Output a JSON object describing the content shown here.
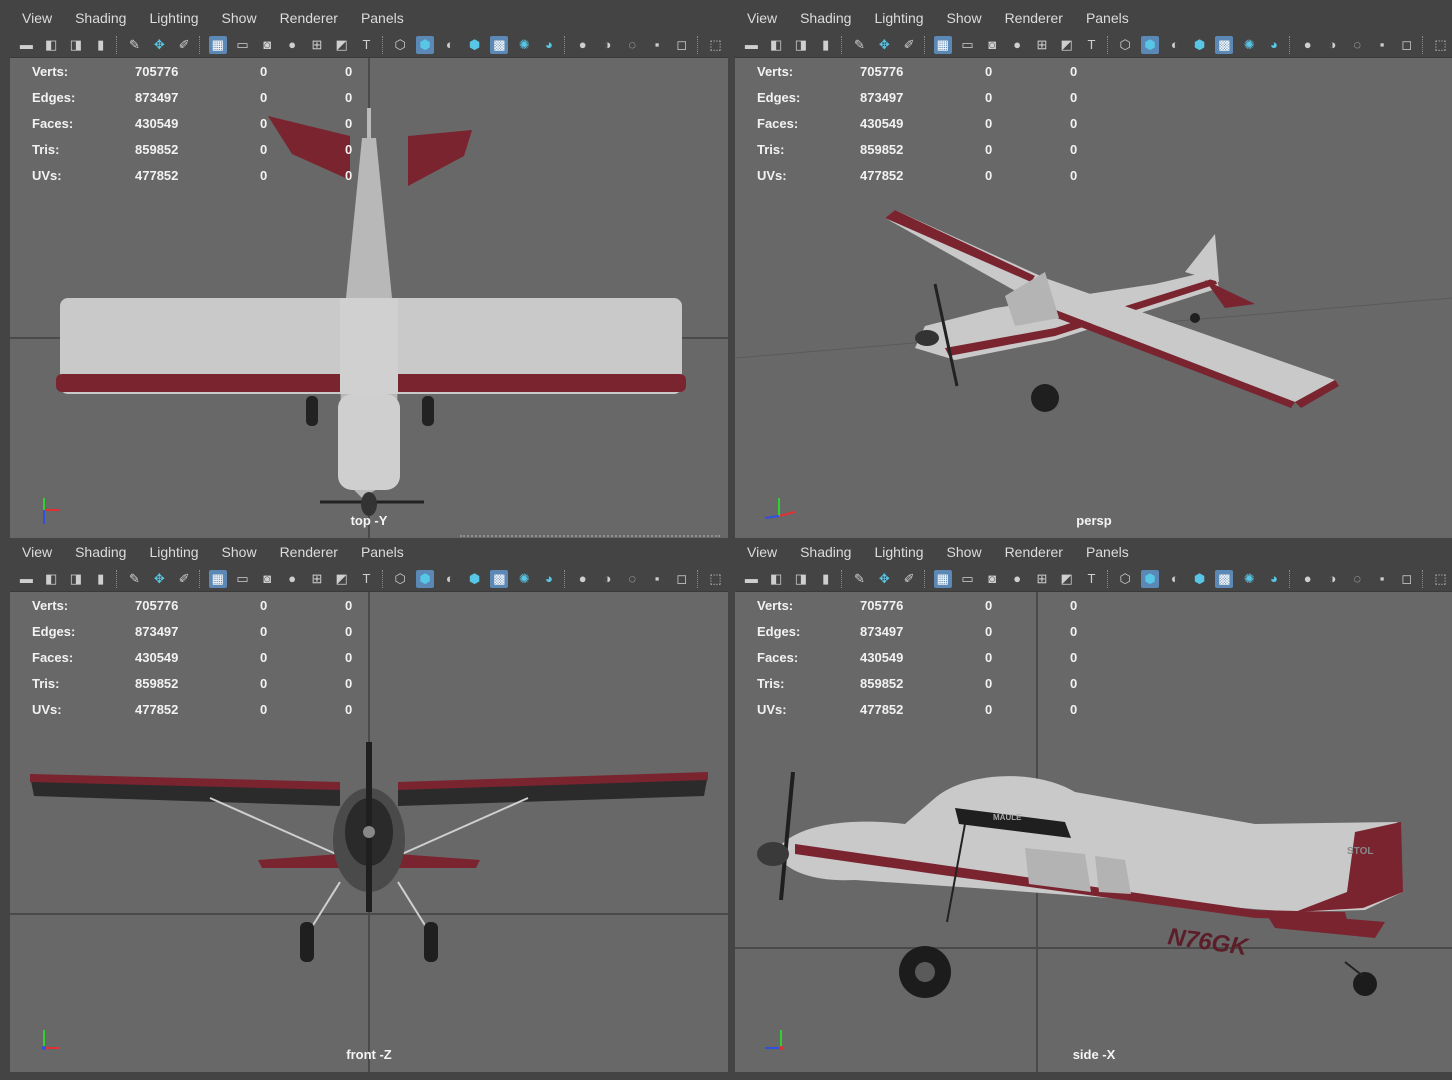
{
  "menu": [
    "View",
    "Shading",
    "Lighting",
    "Show",
    "Renderer",
    "Panels"
  ],
  "hud": {
    "rows": [
      {
        "label": "Verts:",
        "value": "705776",
        "z1": "0",
        "z2": "0"
      },
      {
        "label": "Edges:",
        "value": "873497",
        "z1": "0",
        "z2": "0"
      },
      {
        "label": "Faces:",
        "value": "430549",
        "z1": "0",
        "z2": "0"
      },
      {
        "label": "Tris:",
        "value": "859852",
        "z1": "0",
        "z2": "0"
      },
      {
        "label": "UVs:",
        "value": "477852",
        "z1": "0",
        "z2": "0"
      }
    ]
  },
  "viewports": {
    "top": {
      "camera": "top -Y"
    },
    "persp": {
      "camera": "persp"
    },
    "front": {
      "camera": "front -Z"
    },
    "side": {
      "camera": "side -X"
    }
  },
  "aircraft": {
    "registration": "N76GK",
    "tail_text": "STOL",
    "cowl_text": "MAULE"
  },
  "colors": {
    "background": "#686868",
    "panel": "#444444",
    "maroon": "#7a2430",
    "fuselage": "#c9c9c9",
    "accent": "#5b88b4"
  },
  "toolbar_icons": [
    "camera-icon",
    "camera-lock-icon",
    "camera-attr-icon",
    "bookmark-icon",
    "grease-pencil-icon",
    "snap-icon",
    "paint-icon",
    "grid-icon",
    "film-gate-icon",
    "resolution-gate-icon",
    "gate-mask-icon",
    "field-chart-icon",
    "safe-action-icon",
    "safe-title-icon",
    "wireframe-icon",
    "smooth-shade-icon",
    "default-material-icon",
    "wireframe-on-shaded-icon",
    "textured-icon",
    "lights-icon",
    "shadows-icon",
    "ambient-occlusion-icon",
    "motion-blur-icon",
    "anti-alias-icon",
    "isolate-icon",
    "xray-icon",
    "select-icon"
  ]
}
